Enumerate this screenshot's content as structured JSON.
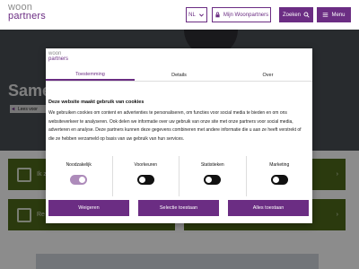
{
  "header": {
    "logo_line1": "woon",
    "logo_line2": "partners",
    "lang_label": "NL",
    "mijn_label": "Mijn Woonpartners",
    "zoeken_label": "Zoeken",
    "menu_label": "Menu"
  },
  "background": {
    "hero_title": "Same",
    "lees_label": "Lees voor",
    "tiles": [
      {
        "label": "Ik z",
        "arrow": "›"
      },
      {
        "label": "",
        "arrow": "›"
      },
      {
        "label": "Re",
        "arrow": "›"
      },
      {
        "label": "",
        "arrow": "›"
      }
    ]
  },
  "dialog": {
    "logo_line1": "woon",
    "logo_line2": "partners",
    "tabs": [
      {
        "label": "Toestemming",
        "active": true
      },
      {
        "label": "Details",
        "active": false
      },
      {
        "label": "Over",
        "active": false
      }
    ],
    "title": "Deze website maakt gebruik van cookies",
    "body": "We gebruiken cookies om content en advertenties te personaliseren, om functies voor social media te bieden en om ons websiteverkeer te analyseren. Ook delen we informatie over uw gebruik van onze site met onze partners voor social media, adverteren en analyse. Deze partners kunnen deze gegevens combineren met andere informatie die u aan ze heeft verstrekt of die ze hebben verzameld op basis van uw gebruik van hun services.",
    "categories": [
      {
        "label": "Noodzakelijk",
        "on": true
      },
      {
        "label": "Voorkeuren",
        "on": false
      },
      {
        "label": "Statistieken",
        "on": false
      },
      {
        "label": "Marketing",
        "on": false
      }
    ],
    "buttons": {
      "deny": "Weigeren",
      "selection": "Selectie toestaan",
      "allow_all": "Alles toestaan"
    }
  },
  "colors": {
    "brand": "#6b2d83",
    "tile_green": "#4f6b1a"
  }
}
